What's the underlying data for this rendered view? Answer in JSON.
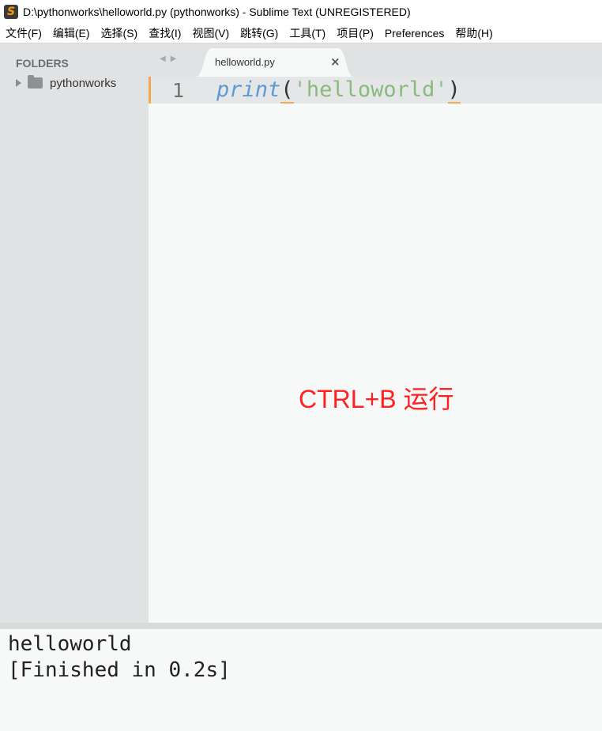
{
  "window": {
    "title": "D:\\pythonworks\\helloworld.py (pythonworks) - Sublime Text (UNREGISTERED)",
    "app_icon_glyph": "S",
    "app_icon_color": "#ff9800"
  },
  "menubar": {
    "items": [
      "文件(F)",
      "编辑(E)",
      "选择(S)",
      "查找(I)",
      "视图(V)",
      "跳转(G)",
      "工具(T)",
      "项目(P)",
      "Preferences",
      "帮助(H)"
    ]
  },
  "sidebar": {
    "header": "FOLDERS",
    "folders": [
      {
        "label": "pythonworks"
      }
    ]
  },
  "tabs": {
    "nav_back": "◀",
    "nav_forward": "▶",
    "active": {
      "label": "helloworld.py",
      "close": "×"
    }
  },
  "editor": {
    "line_number": "1",
    "code": {
      "func": "print",
      "open_paren": "(",
      "quote_open": "'",
      "string": "helloworld",
      "quote_close": "'",
      "close_paren": ")"
    },
    "annotation": "CTRL+B 运行",
    "annotation_color": "#ff2020",
    "accent_color": "#f4a951"
  },
  "output": {
    "lines": [
      "helloworld",
      "[Finished in 0.2s]"
    ]
  }
}
